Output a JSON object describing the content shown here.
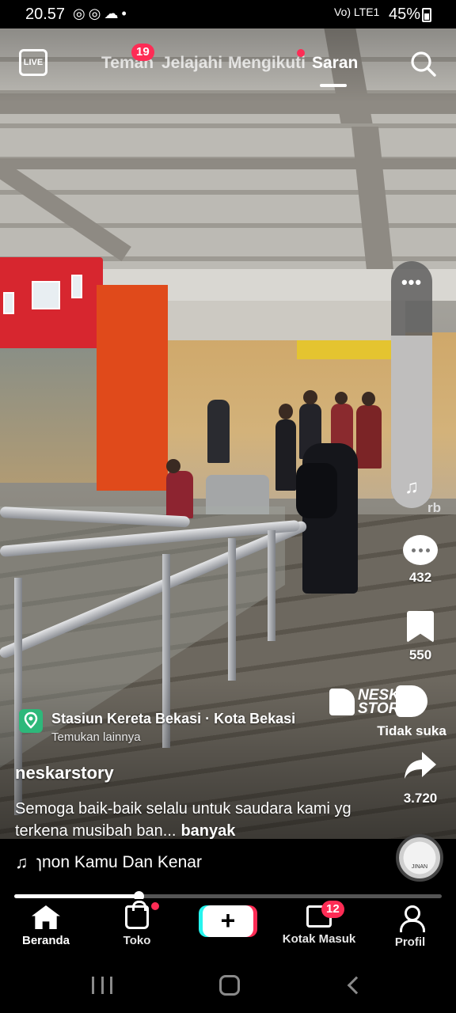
{
  "status_bar": {
    "time": "20.57",
    "notif_icons": "whatsapp-icon whatsapp-icon cloud-icon dot",
    "network": "Vo) LTE1",
    "battery": "45%"
  },
  "top_nav": {
    "live_label": "LIVE",
    "tabs": [
      {
        "label": "Teman",
        "badge": "19"
      },
      {
        "label": "Jelajahi"
      },
      {
        "label": "Mengikuti",
        "dot": true
      },
      {
        "label": "Saran",
        "active": true
      }
    ]
  },
  "volume": {
    "level": 0.7,
    "more_label": "•••"
  },
  "rail": {
    "likes_partial": "rb",
    "comments": "432",
    "bookmarks": "550",
    "dislike_label": "Tidak suka",
    "shares": "3.720"
  },
  "watermark": {
    "line1": "NESKAR",
    "line2": "STORY"
  },
  "location": {
    "title": "Stasiun Kereta Bekasi · Kota Bekasi",
    "subtitle": "Temukan lainnya"
  },
  "post": {
    "username": "neskarstory",
    "caption": "Semoga baik-baik selalu untuk saudara kami yg terkena musibah ban...",
    "more": "banyak"
  },
  "music": {
    "track": "ɿnon    Kamu Dan Kenar",
    "disc_label": "JINAN"
  },
  "progress": {
    "fraction": 0.29
  },
  "bottom_nav": {
    "home": "Beranda",
    "shop": "Toko",
    "create": "+",
    "inbox": "Kotak Masuk",
    "inbox_badge": "12",
    "profile": "Profil"
  },
  "colors": {
    "accent": "#fe2c55",
    "cyan": "#25f4ee"
  }
}
